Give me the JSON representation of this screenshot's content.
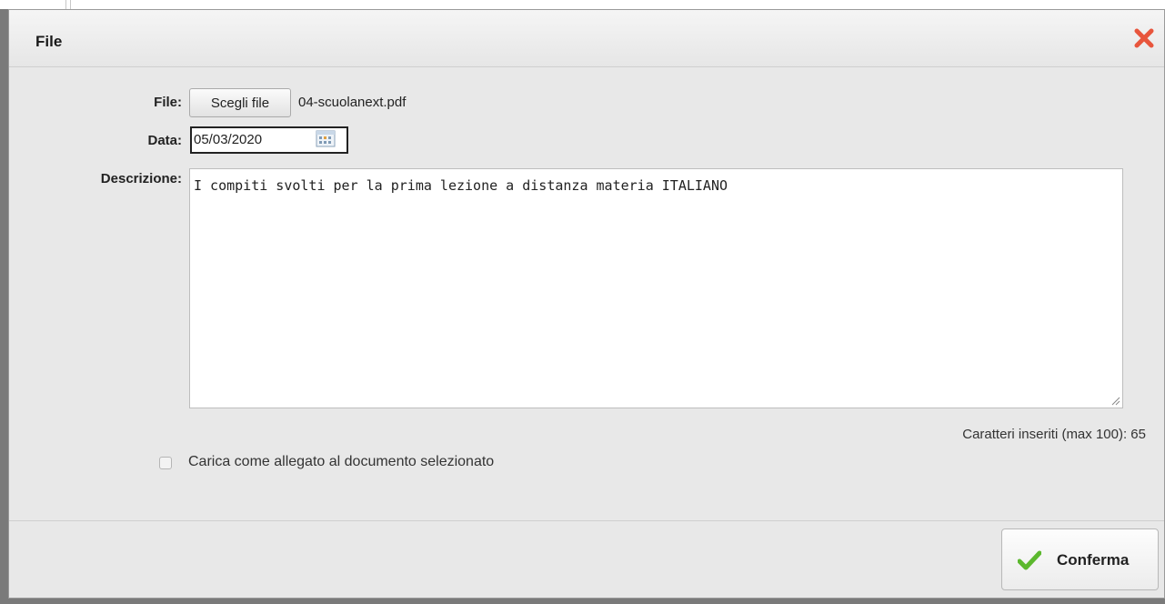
{
  "dialog": {
    "title": "File",
    "close_icon": "close-x-icon"
  },
  "form": {
    "file_label": "File:",
    "file_button_label": "Scegli file",
    "file_name": "04-scuolanext.pdf",
    "date_label": "Data:",
    "date_value": "05/03/2020",
    "description_label": "Descrizione:",
    "description_value": "I compiti svolti per la prima lezione a distanza materia ITALIANO",
    "char_count": "Caratteri inseriti (max 100): 65",
    "attach_checkbox_label": "Carica come allegato al documento selezionato",
    "attach_checked": false
  },
  "footer": {
    "confirm_label": "Conferma",
    "confirm_icon": "checkmark-icon"
  },
  "colors": {
    "close": "#e8553c",
    "check": "#5cb82e"
  }
}
